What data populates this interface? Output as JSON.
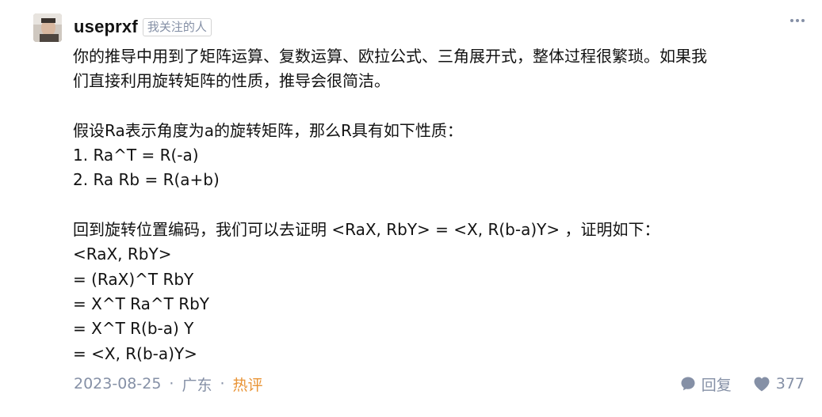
{
  "author": {
    "username": "useprxf",
    "follow_badge": "我关注的人"
  },
  "content": {
    "lines": [
      "你的推导中用到了矩阵运算、复数运算、欧拉公式、三角展开式，整体过程很繁琐。如果我",
      "们直接利用旋转矩阵的性质，推导会很简洁。",
      "",
      "假设Ra表示角度为a的旋转矩阵，那么R具有如下性质：",
      "1. Ra^T = R(-a)",
      "2. Ra Rb = R(a+b)",
      "",
      "回到旋转位置编码，我们可以去证明 <RaX, RbY> = <X, R(b-a)Y> ，证明如下：",
      "<RaX, RbY>",
      "= (RaX)^T RbY",
      "= X^T Ra^T RbY",
      "= X^T R(b-a) Y",
      "= <X, R(b-a)Y>"
    ]
  },
  "meta": {
    "date": "2023-08-25",
    "separator": "·",
    "location": "广东",
    "hot_tag": "热评"
  },
  "actions": {
    "reply_label": "回复",
    "like_count": "377"
  },
  "icons": {
    "more": "more-dots-icon",
    "reply": "reply-bubble-icon",
    "like": "heart-icon"
  },
  "colors": {
    "text": "#121212",
    "muted": "#8590a6",
    "hot": "#e99436"
  }
}
